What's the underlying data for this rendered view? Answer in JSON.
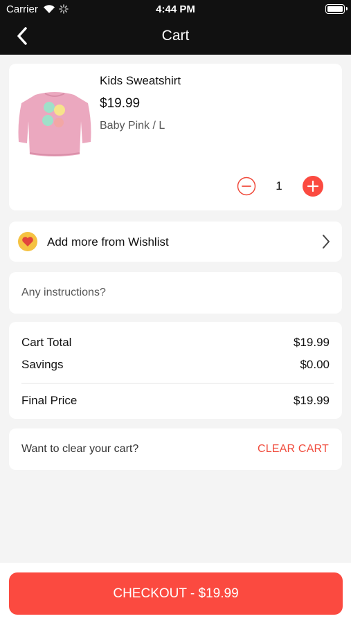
{
  "status_bar": {
    "carrier": "Carrier",
    "time": "4:44 PM"
  },
  "nav": {
    "title": "Cart"
  },
  "cart_item": {
    "name": "Kids Sweatshirt",
    "price": "$19.99",
    "variant": "Baby Pink / L",
    "quantity": "1"
  },
  "wishlist": {
    "label": "Add more from Wishlist"
  },
  "instructions": {
    "placeholder": "Any instructions?"
  },
  "totals": {
    "cart_total_label": "Cart Total",
    "cart_total_value": "$19.99",
    "savings_label": "Savings",
    "savings_value": "$0.00",
    "final_label": "Final Price",
    "final_value": "$19.99"
  },
  "clear": {
    "prompt": "Want to clear your cart?",
    "button": "CLEAR CART"
  },
  "checkout": {
    "label": "CHECKOUT - $19.99"
  },
  "colors": {
    "accent": "#fb4a40",
    "header": "#111111",
    "badge": "#f5c242",
    "sweatshirt": "#eba8bf"
  },
  "icons": [
    "wifi-icon",
    "activity-spinner-icon",
    "battery-icon",
    "back-arrow-icon",
    "minus-circle-icon",
    "plus-circle-icon",
    "heart-icon",
    "chevron-right-icon"
  ]
}
